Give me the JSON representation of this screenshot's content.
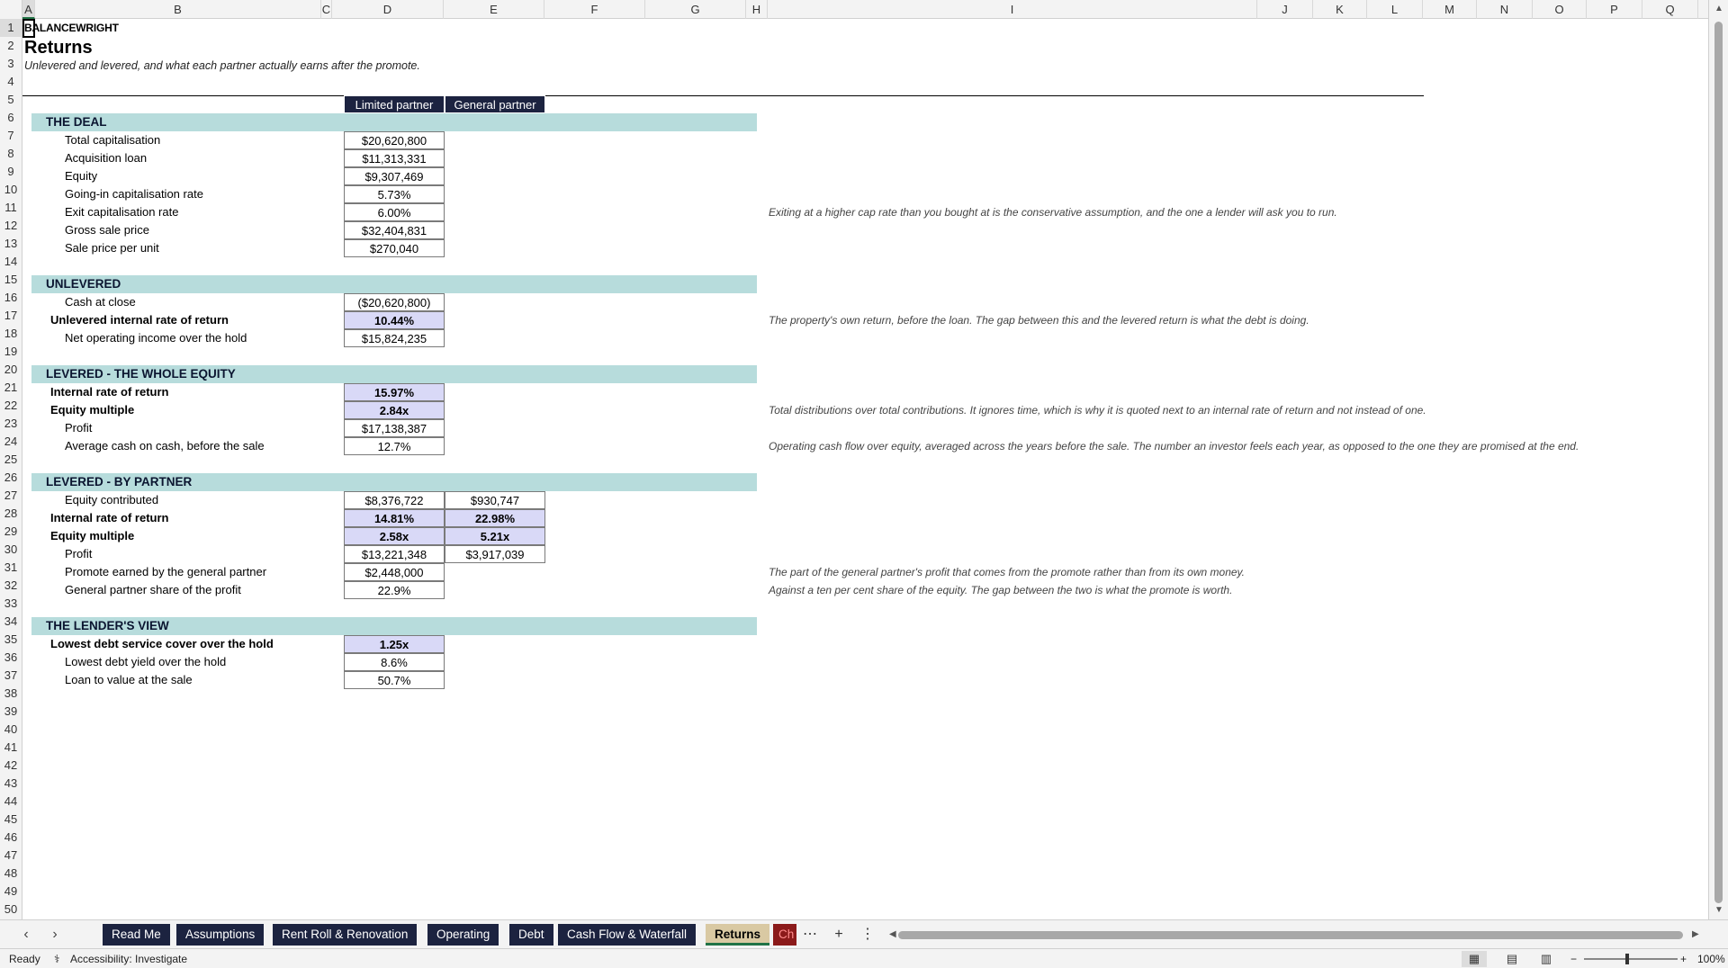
{
  "columns": [
    "A",
    "B",
    "C",
    "D",
    "E",
    "F",
    "G",
    "H",
    "I",
    "J",
    "K",
    "L",
    "M",
    "N",
    "O",
    "P",
    "Q"
  ],
  "rows": [
    "1",
    "2",
    "3",
    "4",
    "5",
    "6",
    "7",
    "8",
    "9",
    "10",
    "11",
    "12",
    "13",
    "14",
    "15",
    "16",
    "17",
    "18",
    "19",
    "20",
    "21",
    "22",
    "23",
    "24",
    "25",
    "26",
    "27",
    "28",
    "29",
    "30",
    "31",
    "32",
    "33",
    "34",
    "35",
    "36",
    "37",
    "38",
    "39",
    "40",
    "41",
    "42",
    "43",
    "44",
    "45",
    "46",
    "47",
    "48",
    "49",
    "50"
  ],
  "sheet": {
    "brand": "BALANCEWRIGHT",
    "title": "Returns",
    "subtitle": "Unlevered and levered, and what each partner actually earns after the promote.",
    "col_d_header": "Limited partner",
    "col_e_header": "General partner",
    "sections": {
      "deal": "THE DEAL",
      "unlevered": "UNLEVERED",
      "levered_whole": "LEVERED - THE WHOLE EQUITY",
      "levered_partner": "LEVERED - BY PARTNER",
      "lender": "THE LENDER'S VIEW"
    },
    "deal": {
      "total_cap_label": "Total capitalisation",
      "total_cap": "$20,620,800",
      "acq_loan_label": "Acquisition loan",
      "acq_loan": "$11,313,331",
      "equity_label": "Equity",
      "equity": "$9,307,469",
      "going_in_label": "Going-in capitalisation rate",
      "going_in": "5.73%",
      "exit_cap_label": "Exit capitalisation rate",
      "exit_cap": "6.00%",
      "gross_sale_label": "Gross sale price",
      "gross_sale": "$32,404,831",
      "per_unit_label": "Sale price per unit",
      "per_unit": "$270,040"
    },
    "unlevered": {
      "cash_close_label": "Cash at close",
      "cash_close": "($20,620,800)",
      "irr_label": "Unlevered internal rate of return",
      "irr": "10.44%",
      "noi_label": "Net operating income over the hold",
      "noi": "$15,824,235"
    },
    "levered_whole": {
      "irr_label": "Internal rate of return",
      "irr": "15.97%",
      "multiple_label": "Equity multiple",
      "multiple": "2.84x",
      "profit_label": "Profit",
      "profit": "$17,138,387",
      "coc_label": "Average cash on cash, before the sale",
      "coc": "12.7%"
    },
    "levered_partner": {
      "equity_label": "Equity contributed",
      "equity_lp": "$8,376,722",
      "equity_gp": "$930,747",
      "irr_label": "Internal rate of return",
      "irr_lp": "14.81%",
      "irr_gp": "22.98%",
      "multiple_label": "Equity multiple",
      "multiple_lp": "2.58x",
      "multiple_gp": "5.21x",
      "profit_label": "Profit",
      "profit_lp": "$13,221,348",
      "profit_gp": "$3,917,039",
      "promote_label": "Promote earned by the general partner",
      "promote": "$2,448,000",
      "gp_share_label": "General partner share of the profit",
      "gp_share": "22.9%"
    },
    "lender": {
      "dscr_label": "Lowest debt service cover over the hold",
      "dscr": "1.25x",
      "debt_yield_label": "Lowest debt yield over the hold",
      "debt_yield": "8.6%",
      "ltv_label": "Loan to value at the sale",
      "ltv": "50.7%"
    },
    "notes": {
      "exit_cap": "Exiting at a higher cap rate than you bought at is the conservative assumption, and the one a lender will ask you to run.",
      "unlevered_irr": "The property's own return, before the loan. The gap between this and the levered return is what the debt is doing.",
      "multiple": "Total distributions over total contributions. It ignores time, which is why it is quoted next to an internal rate of return and not instead of one.",
      "coc": "Operating cash flow over equity, averaged across the years before the sale. The number an investor feels each year, as opposed to the one they are promised at the end.",
      "promote": "The part of the general partner's profit that comes from the promote rather than from its own money.",
      "gp_share": "Against a ten per cent share of the equity. The gap between the two is what the promote is worth."
    }
  },
  "tabs": {
    "read_me": "Read Me",
    "assumptions": "Assumptions",
    "rent_roll": "Rent Roll & Renovation",
    "operating": "Operating",
    "debt": "Debt",
    "cash_flow": "Cash Flow & Waterfall",
    "returns": "Returns",
    "charts_partial": "Ch"
  },
  "status": {
    "ready": "Ready",
    "accessibility": "Accessibility: Investigate",
    "zoom": "100%"
  },
  "icons": {
    "tab_prev": "chevron-left-icon",
    "tab_next": "chevron-right-icon",
    "more_tabs": "ellipsis-icon",
    "add_sheet": "plus-icon",
    "sheet_options": "vertical-ellipsis-icon",
    "normal_view": "grid-view-icon",
    "page_layout": "page-layout-icon",
    "page_break": "page-break-icon",
    "accessibility": "accessibility-icon"
  },
  "colors": {
    "header_navy": "#1c2340",
    "band_teal": "#b7dcdc",
    "highlight_lavender": "#d9d9f7",
    "active_tab": "#d9c9a3",
    "partial_tab": "#8b1a1a",
    "excel_green": "#217346"
  }
}
